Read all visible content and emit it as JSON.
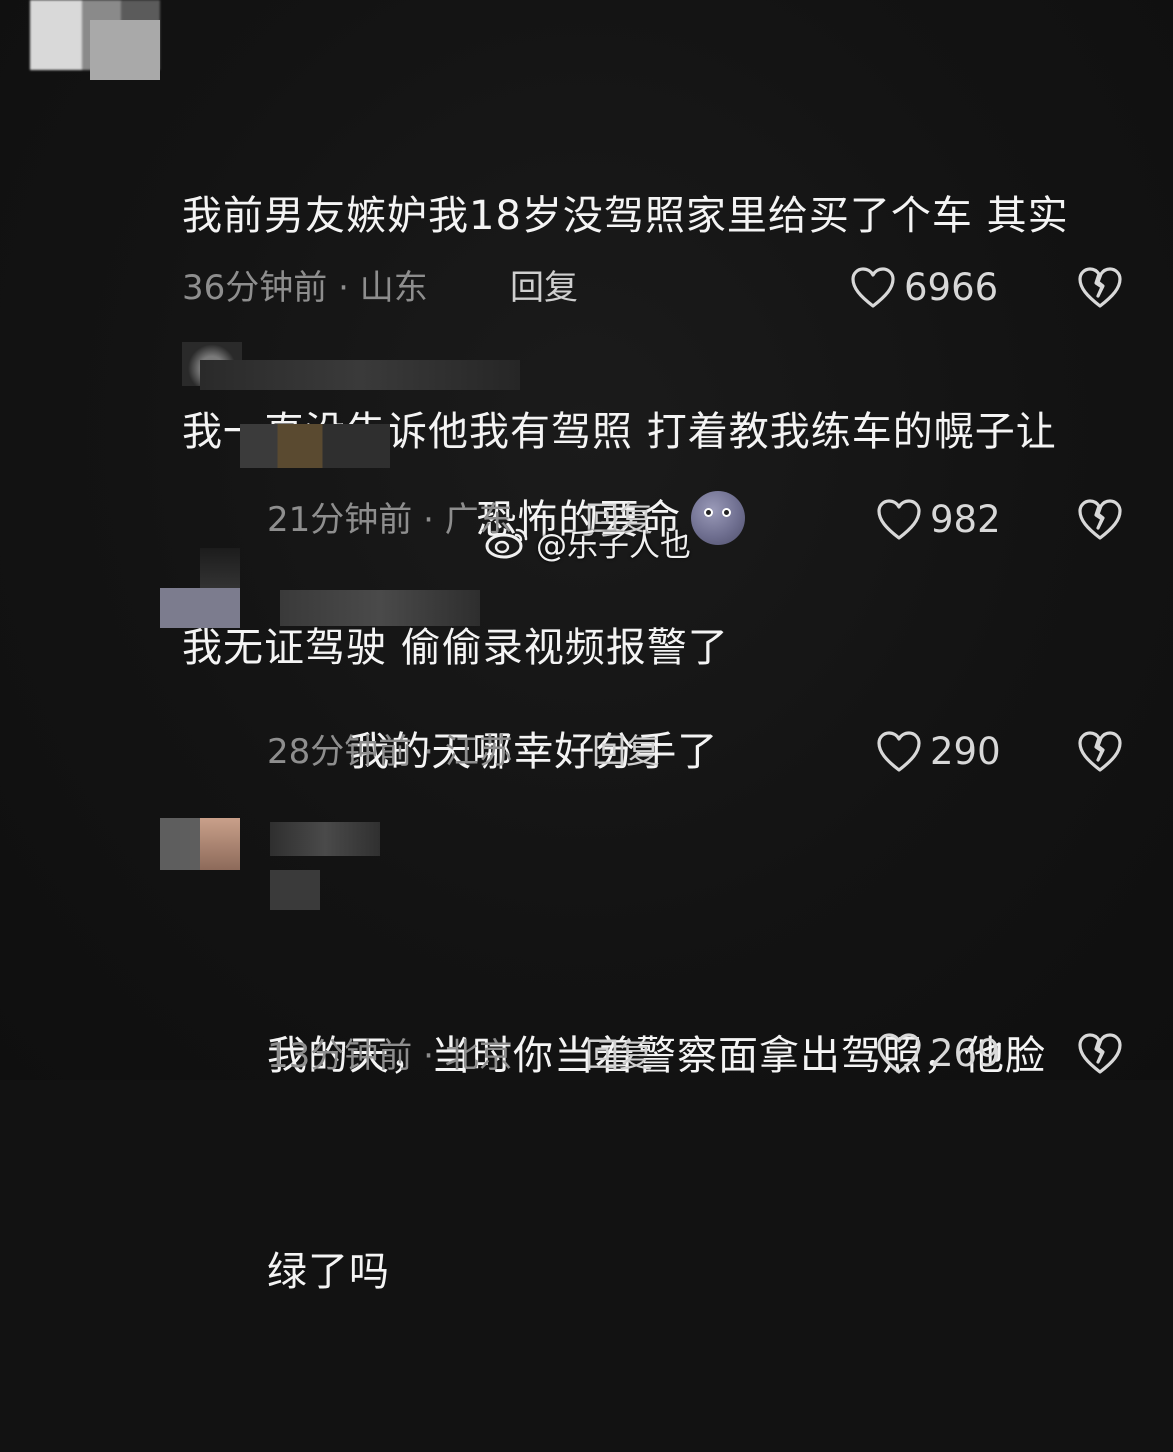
{
  "comments": [
    {
      "text": "我前男友嫉妒我18岁没驾照家里给买了个车 其实我一直没告诉他我有驾照 打着教我练车的幌子让我无证驾驶 偷偷录视频报警了",
      "lines": [
        "我前男友嫉妒我18岁没驾照家里给买了个车 其实",
        "我一直没告诉他我有驾照 打着教我练车的幌子让",
        "我无证驾驶 偷偷录视频报警了"
      ],
      "time": "36分钟前",
      "location": "山东",
      "reply_label": "回复",
      "likes": "6966"
    },
    {
      "text": "恐怖的要命",
      "emoji": "moon-face-emoji",
      "time": "21分钟前",
      "location": "广东",
      "reply_label": "回复",
      "likes": "982"
    },
    {
      "text": "我的天哪幸好分手了",
      "time": "28分钟前",
      "location": "江苏",
      "reply_label": "回复",
      "likes": "290"
    },
    {
      "text": "我的天，当时你当着警察面拿出驾照，他脸绿了吗",
      "lines": [
        "我的天，当时你当着警察面拿出驾照，他脸",
        "绿了吗"
      ],
      "time": "13分钟前",
      "location": "北京",
      "reply_label": "回复",
      "likes": "269"
    }
  ],
  "watermark": {
    "icon": "weibo-icon",
    "text": "@乐子人也"
  },
  "colors": {
    "background": "#121212",
    "text": "#f4f4f4",
    "meta": "#8e8e8e"
  }
}
